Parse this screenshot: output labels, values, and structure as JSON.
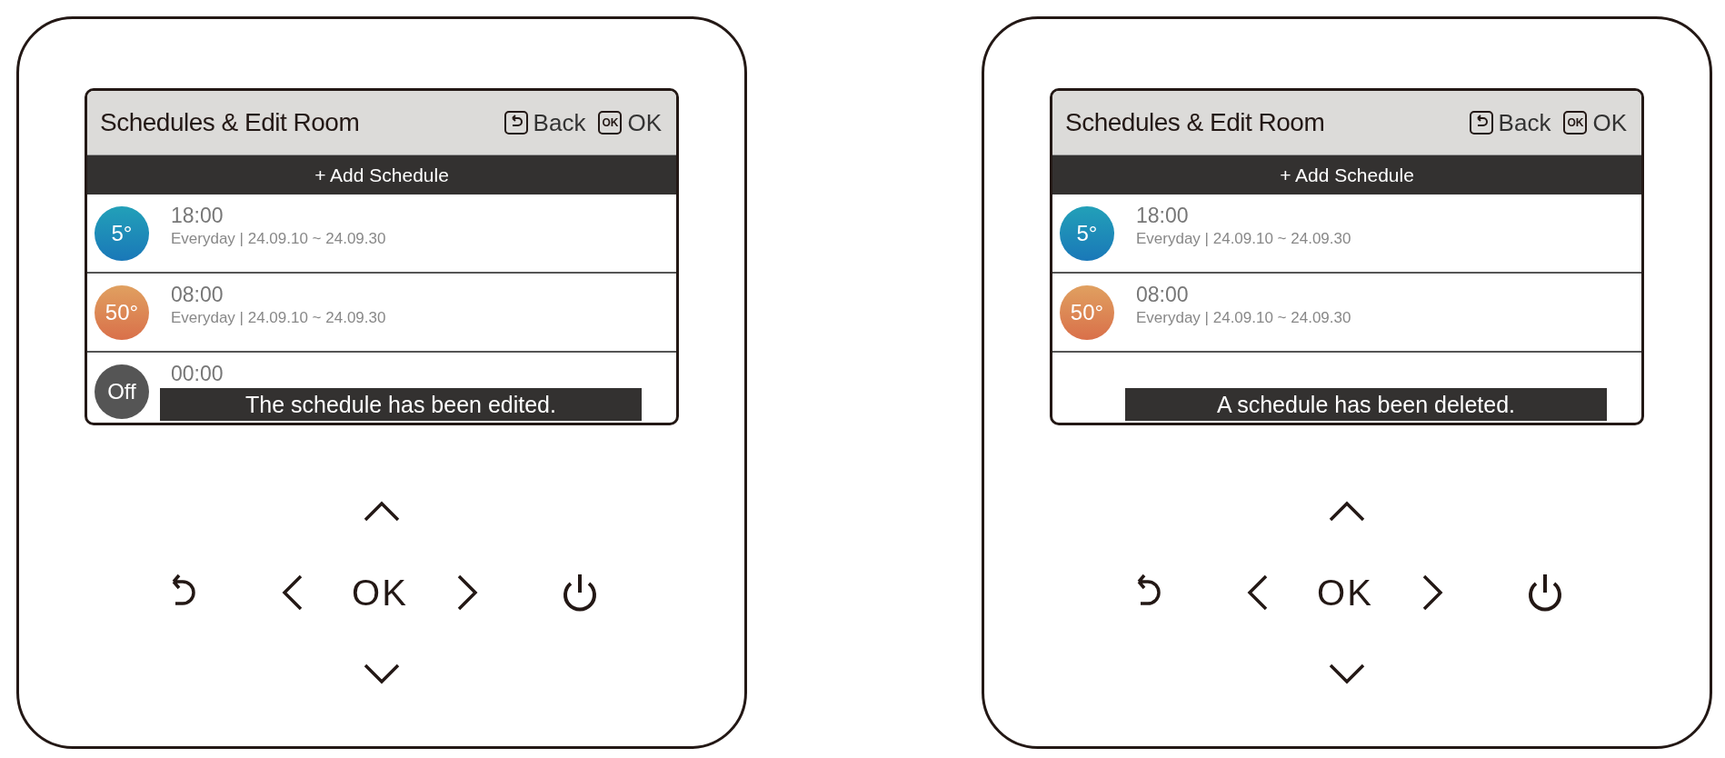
{
  "panels": [
    {
      "screen": {
        "title": "Schedules & Edit Room",
        "header_buttons": [
          {
            "kind": "back",
            "label": "Back"
          },
          {
            "kind": "ok",
            "key": "OK",
            "label": "OK"
          }
        ],
        "add_button": "+ Add Schedule",
        "schedules": [
          {
            "kind": "cool",
            "temperature": "5°",
            "time": "18:00",
            "detail": "Everyday | 24.09.10 ~ 24.09.30"
          },
          {
            "kind": "heat",
            "temperature": "50°",
            "time": "08:00",
            "detail": "Everyday | 24.09.10 ~ 24.09.30"
          },
          {
            "kind": "off",
            "temperature": "Off",
            "time": "00:00"
          }
        ],
        "toast": "The schedule has been edited."
      },
      "keypad": {
        "ok_label": "OK"
      }
    },
    {
      "screen": {
        "title": "Schedules & Edit Room",
        "header_buttons": [
          {
            "kind": "back",
            "label": "Back"
          },
          {
            "kind": "ok",
            "key": "OK",
            "label": "OK"
          }
        ],
        "add_button": "+ Add Schedule",
        "schedules": [
          {
            "kind": "cool",
            "temperature": "5°",
            "time": "18:00",
            "detail": "Everyday | 24.09.10 ~ 24.09.30"
          },
          {
            "kind": "heat",
            "temperature": "50°",
            "time": "08:00",
            "detail": "Everyday | 24.09.10 ~ 24.09.30"
          }
        ],
        "toast": "A schedule has been deleted."
      },
      "keypad": {
        "ok_label": "OK"
      }
    }
  ]
}
